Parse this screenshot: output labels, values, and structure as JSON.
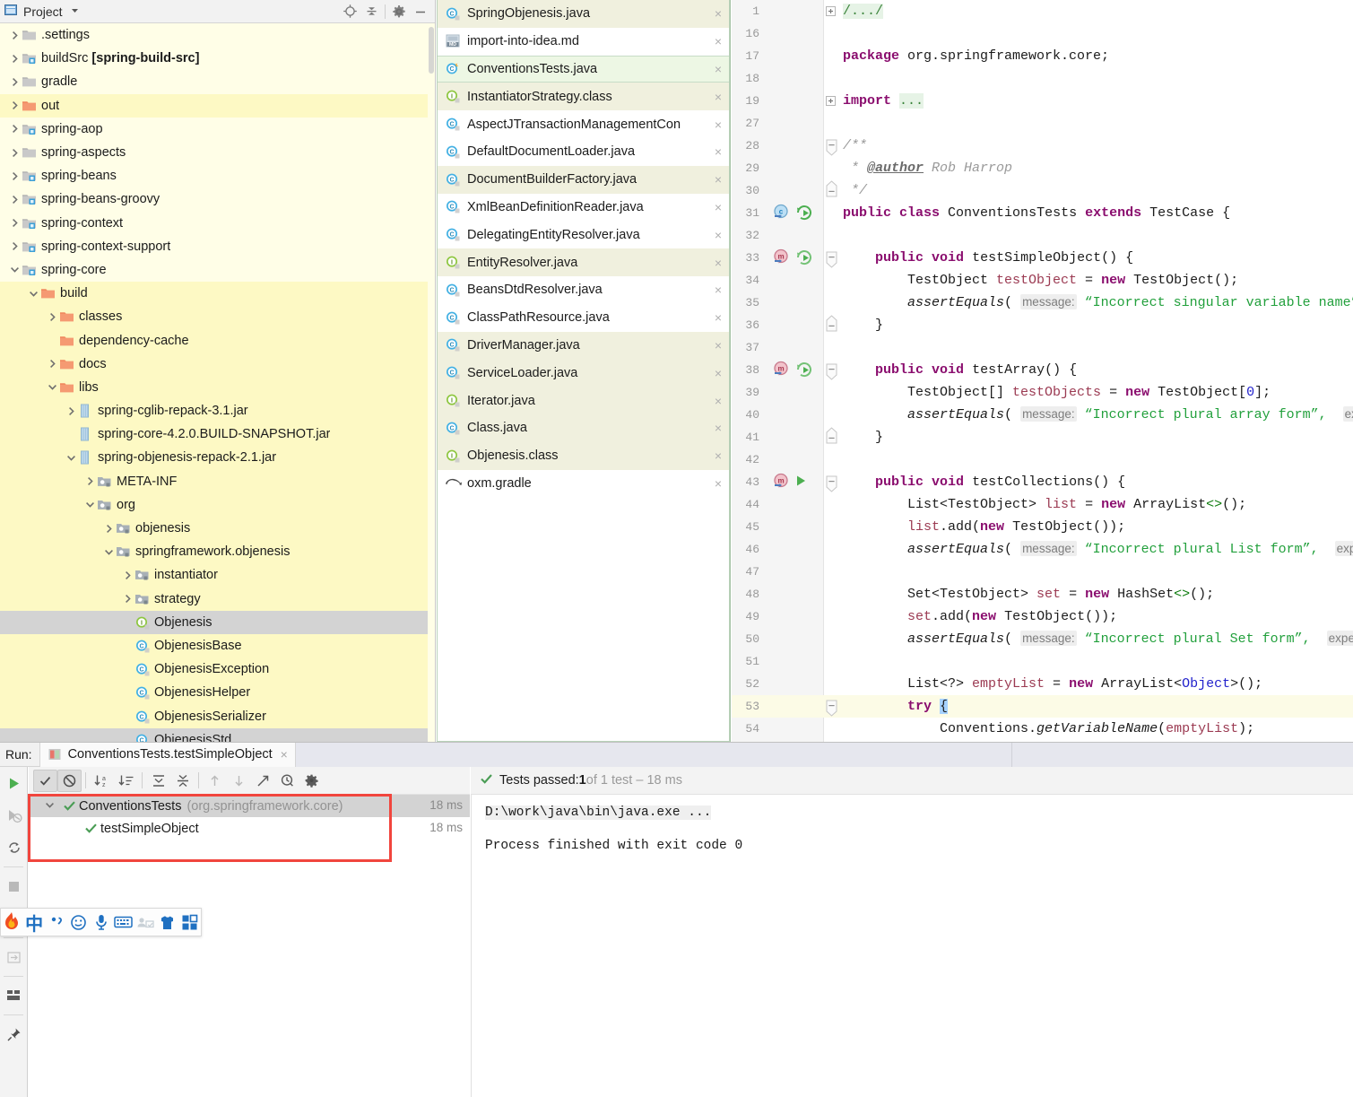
{
  "project_panel": {
    "title": "Project",
    "icons": [
      "project-dropdown-icon",
      "locate-icon",
      "collapse-all-icon",
      "gear-icon",
      "minimize-icon"
    ],
    "tree": [
      {
        "label": ".settings",
        "depth": 0,
        "arrow": "right",
        "icon": "folder",
        "state": "normal"
      },
      {
        "label": "buildSrc ",
        "bold": "[spring-build-src]",
        "depth": 0,
        "arrow": "right",
        "icon": "module",
        "state": "normal"
      },
      {
        "label": "gradle",
        "depth": 0,
        "arrow": "right",
        "icon": "folder",
        "state": "normal"
      },
      {
        "label": "out",
        "depth": 0,
        "arrow": "right",
        "icon": "folder-orange",
        "state": "highlight"
      },
      {
        "label": "spring-aop",
        "depth": 0,
        "arrow": "right",
        "icon": "module",
        "state": "normal"
      },
      {
        "label": "spring-aspects",
        "depth": 0,
        "arrow": "right",
        "icon": "folder",
        "state": "normal"
      },
      {
        "label": "spring-beans",
        "depth": 0,
        "arrow": "right",
        "icon": "module",
        "state": "normal"
      },
      {
        "label": "spring-beans-groovy",
        "depth": 0,
        "arrow": "right",
        "icon": "module",
        "state": "normal"
      },
      {
        "label": "spring-context",
        "depth": 0,
        "arrow": "right",
        "icon": "module",
        "state": "normal"
      },
      {
        "label": "spring-context-support",
        "depth": 0,
        "arrow": "right",
        "icon": "module",
        "state": "normal"
      },
      {
        "label": "spring-core",
        "depth": 0,
        "arrow": "down",
        "icon": "module",
        "state": "normal"
      },
      {
        "label": "build",
        "depth": 1,
        "arrow": "down",
        "icon": "folder-orange",
        "state": "highlight"
      },
      {
        "label": "classes",
        "depth": 2,
        "arrow": "right",
        "icon": "folder-orange",
        "state": "highlight"
      },
      {
        "label": "dependency-cache",
        "depth": 2,
        "arrow": "none",
        "icon": "folder-orange",
        "state": "highlight"
      },
      {
        "label": "docs",
        "depth": 2,
        "arrow": "right",
        "icon": "folder-orange",
        "state": "highlight"
      },
      {
        "label": "libs",
        "depth": 2,
        "arrow": "down",
        "icon": "folder-orange",
        "state": "highlight"
      },
      {
        "label": "spring-cglib-repack-3.1.jar",
        "depth": 3,
        "arrow": "right",
        "icon": "jar",
        "state": "highlight"
      },
      {
        "label": "spring-core-4.2.0.BUILD-SNAPSHOT.jar",
        "depth": 3,
        "arrow": "none",
        "icon": "jar",
        "state": "highlight"
      },
      {
        "label": "spring-objenesis-repack-2.1.jar",
        "depth": 3,
        "arrow": "down",
        "icon": "jar",
        "state": "highlight"
      },
      {
        "label": "META-INF",
        "depth": 4,
        "arrow": "right",
        "icon": "package",
        "state": "highlight"
      },
      {
        "label": "org",
        "depth": 4,
        "arrow": "down",
        "icon": "package",
        "state": "highlight"
      },
      {
        "label": "objenesis",
        "depth": 5,
        "arrow": "right",
        "icon": "package",
        "state": "highlight"
      },
      {
        "label": "springframework.objenesis",
        "depth": 5,
        "arrow": "down",
        "icon": "package",
        "state": "highlight"
      },
      {
        "label": "instantiator",
        "depth": 6,
        "arrow": "right",
        "icon": "package",
        "state": "highlight"
      },
      {
        "label": "strategy",
        "depth": 6,
        "arrow": "right",
        "icon": "package",
        "state": "highlight"
      },
      {
        "label": "Objenesis",
        "depth": 6,
        "arrow": "none",
        "icon": "interface",
        "state": "selected"
      },
      {
        "label": "ObjenesisBase",
        "depth": 6,
        "arrow": "none",
        "icon": "class",
        "state": "highlight"
      },
      {
        "label": "ObjenesisException",
        "depth": 6,
        "arrow": "none",
        "icon": "class",
        "state": "highlight"
      },
      {
        "label": "ObjenesisHelper",
        "depth": 6,
        "arrow": "none",
        "icon": "class",
        "state": "highlight"
      },
      {
        "label": "ObjenesisSerializer",
        "depth": 6,
        "arrow": "none",
        "icon": "class",
        "state": "highlight"
      },
      {
        "label": "ObjenesisStd",
        "depth": 6,
        "arrow": "none",
        "icon": "class",
        "state": "selected"
      }
    ]
  },
  "file_list": [
    {
      "name": "SpringObjenesis.java",
      "icon": "class",
      "state": "modified",
      "close": "×"
    },
    {
      "name": "import-into-idea.md",
      "icon": "markdown",
      "state": "plain",
      "close": "×"
    },
    {
      "name": "ConventionsTests.java",
      "icon": "class-run",
      "state": "selected",
      "close": "×"
    },
    {
      "name": "InstantiatorStrategy.class",
      "icon": "interface",
      "state": "modified",
      "close": "×"
    },
    {
      "name": "AspectJTransactionManagementCon",
      "icon": "class",
      "state": "plain",
      "close": "×"
    },
    {
      "name": "DefaultDocumentLoader.java",
      "icon": "class",
      "state": "plain",
      "close": "×"
    },
    {
      "name": "DocumentBuilderFactory.java",
      "icon": "class",
      "state": "modified",
      "close": "×"
    },
    {
      "name": "XmlBeanDefinitionReader.java",
      "icon": "class",
      "state": "plain",
      "close": "×"
    },
    {
      "name": "DelegatingEntityResolver.java",
      "icon": "class",
      "state": "plain",
      "close": "×"
    },
    {
      "name": "EntityResolver.java",
      "icon": "interface",
      "state": "modified",
      "close": "×"
    },
    {
      "name": "BeansDtdResolver.java",
      "icon": "class",
      "state": "plain",
      "close": "×"
    },
    {
      "name": "ClassPathResource.java",
      "icon": "class",
      "state": "plain",
      "close": "×"
    },
    {
      "name": "DriverManager.java",
      "icon": "class",
      "state": "modified",
      "close": "×"
    },
    {
      "name": "ServiceLoader.java",
      "icon": "class",
      "state": "modified",
      "close": "×"
    },
    {
      "name": "Iterator.java",
      "icon": "interface",
      "state": "modified",
      "close": "×"
    },
    {
      "name": "Class.java",
      "icon": "class",
      "state": "modified",
      "close": "×"
    },
    {
      "name": "Objenesis.class",
      "icon": "interface",
      "state": "modified",
      "close": "×"
    },
    {
      "name": "oxm.gradle",
      "icon": "gradle",
      "state": "plain",
      "close": "×"
    }
  ],
  "editor": {
    "lines": [
      {
        "num": "1",
        "fold": "plus"
      },
      {
        "num": "16"
      },
      {
        "num": "17"
      },
      {
        "num": "18"
      },
      {
        "num": "19",
        "fold": "plus"
      },
      {
        "num": "27"
      },
      {
        "num": "28",
        "fold": "top"
      },
      {
        "num": "29"
      },
      {
        "num": "30",
        "fold": "bottom"
      },
      {
        "num": "31",
        "gutter": "class-run"
      },
      {
        "num": "32"
      },
      {
        "num": "33",
        "gutter": "method-run",
        "fold": "top"
      },
      {
        "num": "34"
      },
      {
        "num": "35"
      },
      {
        "num": "36",
        "fold": "bottom"
      },
      {
        "num": "37"
      },
      {
        "num": "38",
        "gutter": "method-run",
        "fold": "top"
      },
      {
        "num": "39"
      },
      {
        "num": "40"
      },
      {
        "num": "41",
        "fold": "bottom"
      },
      {
        "num": "42"
      },
      {
        "num": "43",
        "gutter": "method-play",
        "fold": "top"
      },
      {
        "num": "44"
      },
      {
        "num": "45"
      },
      {
        "num": "46"
      },
      {
        "num": "47"
      },
      {
        "num": "48"
      },
      {
        "num": "49"
      },
      {
        "num": "50"
      },
      {
        "num": "51"
      },
      {
        "num": "52"
      },
      {
        "num": "53",
        "fold": "top",
        "current": true
      },
      {
        "num": "54"
      }
    ],
    "code_text": {
      "l1": "/.../",
      "l17": "package org.springframework.core;",
      "l19": "import ...",
      "l28": "/**",
      "l29": "* @author Rob Harrop",
      "l30": "*/",
      "l31": "public class ConventionsTests extends TestCase {",
      "l33": "public void testSimpleObject() {",
      "l34": "TestObject testObject = new TestObject();",
      "l35_call": "assertEquals(",
      "l35_hint": "message:",
      "l35_str": "“Incorrect singular variable name”",
      "l36": "}",
      "l38": "public void testArray() {",
      "l39": "TestObject[] testObjects = new TestObject[0];",
      "l40_str": "“Incorrect plural array form”,",
      "l40_hint2": "ex",
      "l41": "}",
      "l43": "public void testCollections() {",
      "l44": "List<TestObject> list = new ArrayList<>();",
      "l45": "list.add(new TestObject());",
      "l46_str": "“Incorrect plural List form”,",
      "l46_hint2": "exp",
      "l48": "Set<TestObject> set = new HashSet<>();",
      "l49": "set.add(new TestObject());",
      "l50_str": "“Incorrect plural Set form”,",
      "l50_hint2": "expe",
      "l52": "List<?> emptyList = new ArrayList<Object>();",
      "l53": "try {",
      "l54": "Conventions.getVariableName(emptyList);"
    }
  },
  "run_panel": {
    "run_label": "Run:",
    "tab_title": "ConventionsTests.testSimpleObject",
    "tab_close": "×",
    "left_toolbar": [
      "rerun-icon",
      "rerun-failed-icon",
      "rerun-auto-icon",
      "stop-icon",
      "dump-threads-icon"
    ],
    "toolbar": [
      "show-passed-icon",
      "hide-ignored-icon",
      "sort-alphabetically-icon",
      "sort-by-duration-icon",
      "expand-all-icon",
      "collapse-all-icon",
      "prev-failed-icon",
      "next-failed-icon",
      "export-icon",
      "history-icon",
      "settings-icon"
    ],
    "tests": [
      {
        "label": "ConventionsTests",
        "package": "(org.springframework.core)",
        "duration": "18 ms",
        "status": "passed",
        "depth": 0,
        "selected": true,
        "arrow": "down"
      },
      {
        "label": "testSimpleObject",
        "package": "",
        "duration": "18 ms",
        "status": "passed",
        "depth": 1,
        "selected": false,
        "arrow": "none"
      }
    ],
    "status_prefix": "Tests passed: ",
    "status_count": "1",
    "status_suffix": " of 1 test – 18 ms",
    "console": {
      "line1": "D:\\work\\java\\bin\\java.exe ...",
      "line2": "Process finished with exit code 0"
    }
  },
  "ime_bar": {
    "buttons": [
      "flame-logo-icon",
      "chinese-mode-icon",
      "punctuation-icon",
      "emoji-icon",
      "microphone-icon",
      "keyboard-icon",
      "handwriting-icon",
      "skin-icon",
      "apps-icon"
    ],
    "chinese_glyph": "中"
  },
  "colors": {
    "tree_bg": "#fffee7",
    "selection": "#d3d3d3",
    "tab_selected": "#edf7e4",
    "tab_modified": "#f0f0de",
    "red_highlight": "#f1453d",
    "accent_green": "#22a03c",
    "keyword": "#8a0d6e"
  }
}
